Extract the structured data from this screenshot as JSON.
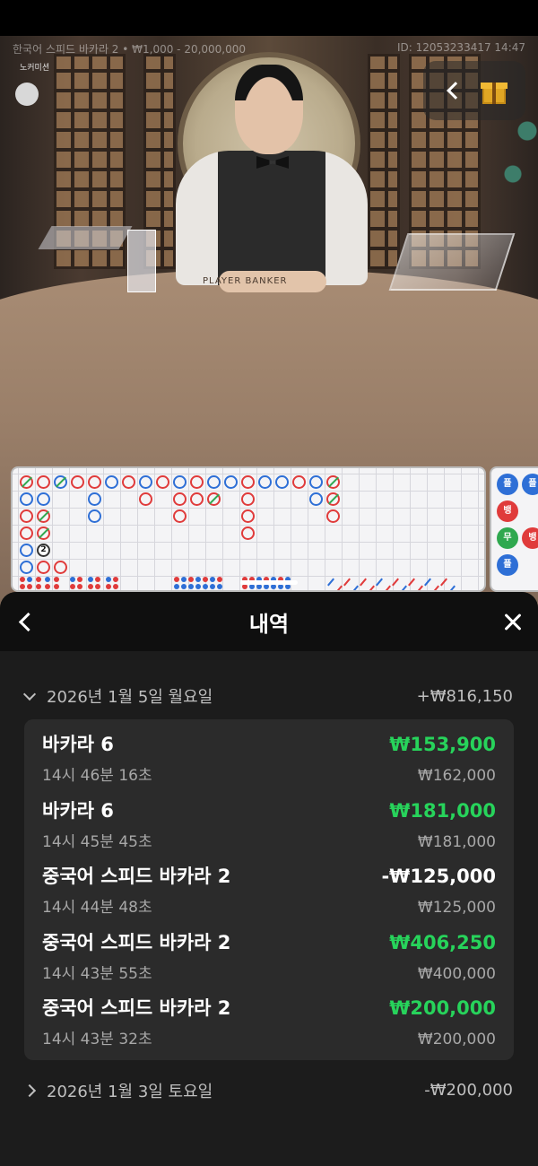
{
  "stream": {
    "table_info": "한국어 스피드 바카라 2 • ₩1,000 - 20,000,000",
    "round_id": "ID: 12053233417 14:47",
    "no_commission": "노커미션",
    "table_print": "PLAYER BANKER"
  },
  "beads": [
    "플",
    "뱅",
    "무",
    "플",
    "플",
    "뱅"
  ],
  "history": {
    "title": "내역",
    "days": [
      {
        "date": "2026년 1월 5일 월요일",
        "total": "+₩816,150",
        "expanded": true,
        "items": [
          {
            "game": "바카라 6",
            "time": "14시 46분 16초",
            "result": "₩153,900",
            "bet": "₩162,000",
            "positive": true
          },
          {
            "game": "바카라 6",
            "time": "14시 45분 45초",
            "result": "₩181,000",
            "bet": "₩181,000",
            "positive": true
          },
          {
            "game": "중국어 스피드 바카라 2",
            "time": "14시 44분 48초",
            "result": "-₩125,000",
            "bet": "₩125,000",
            "positive": false
          },
          {
            "game": "중국어 스피드 바카라 2",
            "time": "14시 43분 55초",
            "result": "₩406,250",
            "bet": "₩400,000",
            "positive": true
          },
          {
            "game": "중국어 스피드 바카라 2",
            "time": "14시 43분 32초",
            "result": "₩200,000",
            "bet": "₩200,000",
            "positive": true
          }
        ]
      },
      {
        "date": "2026년 1월 3일 토요일",
        "total": "-₩200,000",
        "expanded": false
      }
    ]
  },
  "colors": {
    "win": "#27d35b",
    "banker": "#e03b3b",
    "player": "#2e6fd6",
    "tie": "#2fa84f"
  }
}
